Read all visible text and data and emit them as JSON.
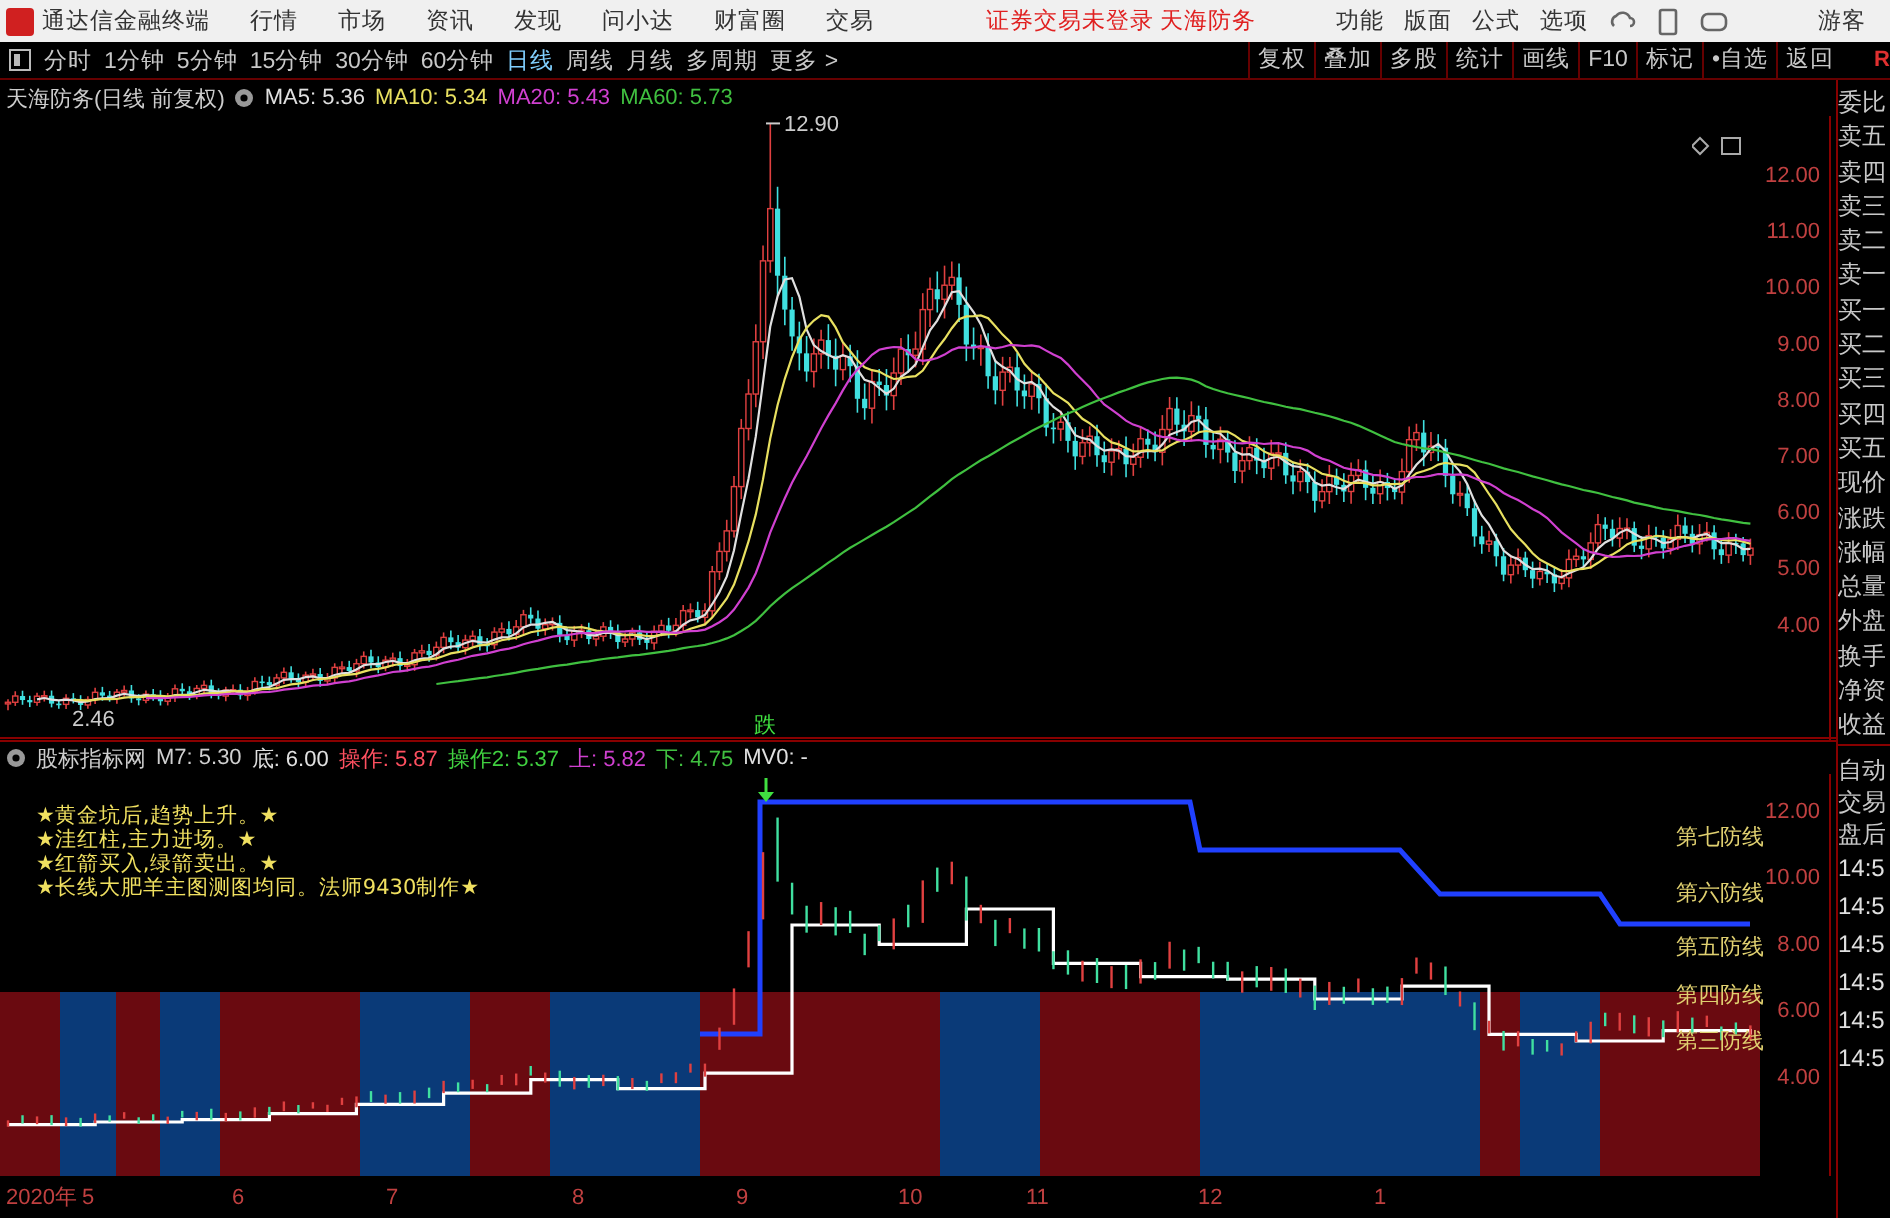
{
  "app_bar": {
    "title": "通达信金融终端",
    "menus": [
      "行情",
      "市场",
      "资讯",
      "发现",
      "问小达",
      "财富圈",
      "交易"
    ],
    "status": "证券交易未登录 天海防务",
    "tools": [
      "功能",
      "版面",
      "公式",
      "选项"
    ],
    "user": "游客"
  },
  "periods": [
    {
      "label": "分时",
      "selected": false
    },
    {
      "label": "1分钟",
      "selected": false
    },
    {
      "label": "5分钟",
      "selected": false
    },
    {
      "label": "15分钟",
      "selected": false
    },
    {
      "label": "30分钟",
      "selected": false
    },
    {
      "label": "60分钟",
      "selected": false
    },
    {
      "label": "日线",
      "selected": true
    },
    {
      "label": "周线",
      "selected": false
    },
    {
      "label": "月线",
      "selected": false
    },
    {
      "label": "多周期",
      "selected": false
    },
    {
      "label": "更多 >",
      "selected": false
    }
  ],
  "actions": [
    "复权",
    "叠加",
    "多股",
    "统计",
    "画线",
    "F10",
    "标记",
    "•自选",
    "返回"
  ],
  "corner_mark": "R",
  "price_chart": {
    "title": "天海防务(日线 前复权)",
    "mas": [
      {
        "label": "MA5: 5.36",
        "color": "#e0e0e0"
      },
      {
        "label": "MA10: 5.34",
        "color": "#e8e060"
      },
      {
        "label": "MA20: 5.43",
        "color": "#d040d0"
      },
      {
        "label": "MA60: 5.73",
        "color": "#40c040"
      }
    ],
    "high_label": "12.90",
    "low_label": "2.46",
    "axis": [
      "12.00",
      "11.00",
      "10.00",
      "9.00",
      "8.00",
      "7.00",
      "6.00",
      "5.00",
      "4.00"
    ]
  },
  "indicator": {
    "title": "股标指标网",
    "items": [
      {
        "label": "M7: 5.30",
        "color": "#d0d0d0"
      },
      {
        "label": "底: 6.00",
        "color": "#e0e0e0"
      },
      {
        "label": "操作: 5.87",
        "color": "#ff5060"
      },
      {
        "label": "操作2: 5.37",
        "color": "#40d040"
      },
      {
        "label": "上: 5.82",
        "color": "#d040d0"
      },
      {
        "label": "下: 4.75",
        "color": "#40c040"
      },
      {
        "label": "MV0: -",
        "color": "#e0e0e0"
      }
    ],
    "signal": "跌",
    "notes": [
      "★黄金坑后,趋势上升。★",
      "★洼红柱,主力进场。★",
      "★红箭买入,绿箭卖出。★",
      "★长线大肥羊主图测图均同。法师9430制作★"
    ],
    "lines": [
      "第七防线",
      "第六防线",
      "第五防线",
      "第四防线",
      "第三防线"
    ],
    "axis": [
      "12.00",
      "10.00",
      "8.00",
      "6.00",
      "4.00"
    ]
  },
  "time_axis": [
    "2020年",
    "5",
    "6",
    "7",
    "8",
    "9",
    "10",
    "11",
    "12",
    "1"
  ],
  "quote_panel": {
    "fields": [
      "委比",
      "卖五",
      "卖四",
      "卖三",
      "卖二",
      "卖一",
      "买一",
      "买二",
      "买三",
      "买四",
      "买五",
      "现价",
      "涨跌",
      "涨幅",
      "总量",
      "外盘",
      "换手",
      "净资",
      "收益"
    ],
    "modes": [
      "自动",
      "交易",
      "盘后"
    ],
    "times": [
      "14:5",
      "14:5",
      "14:5",
      "14:5",
      "14:5",
      "14:5"
    ]
  }
}
